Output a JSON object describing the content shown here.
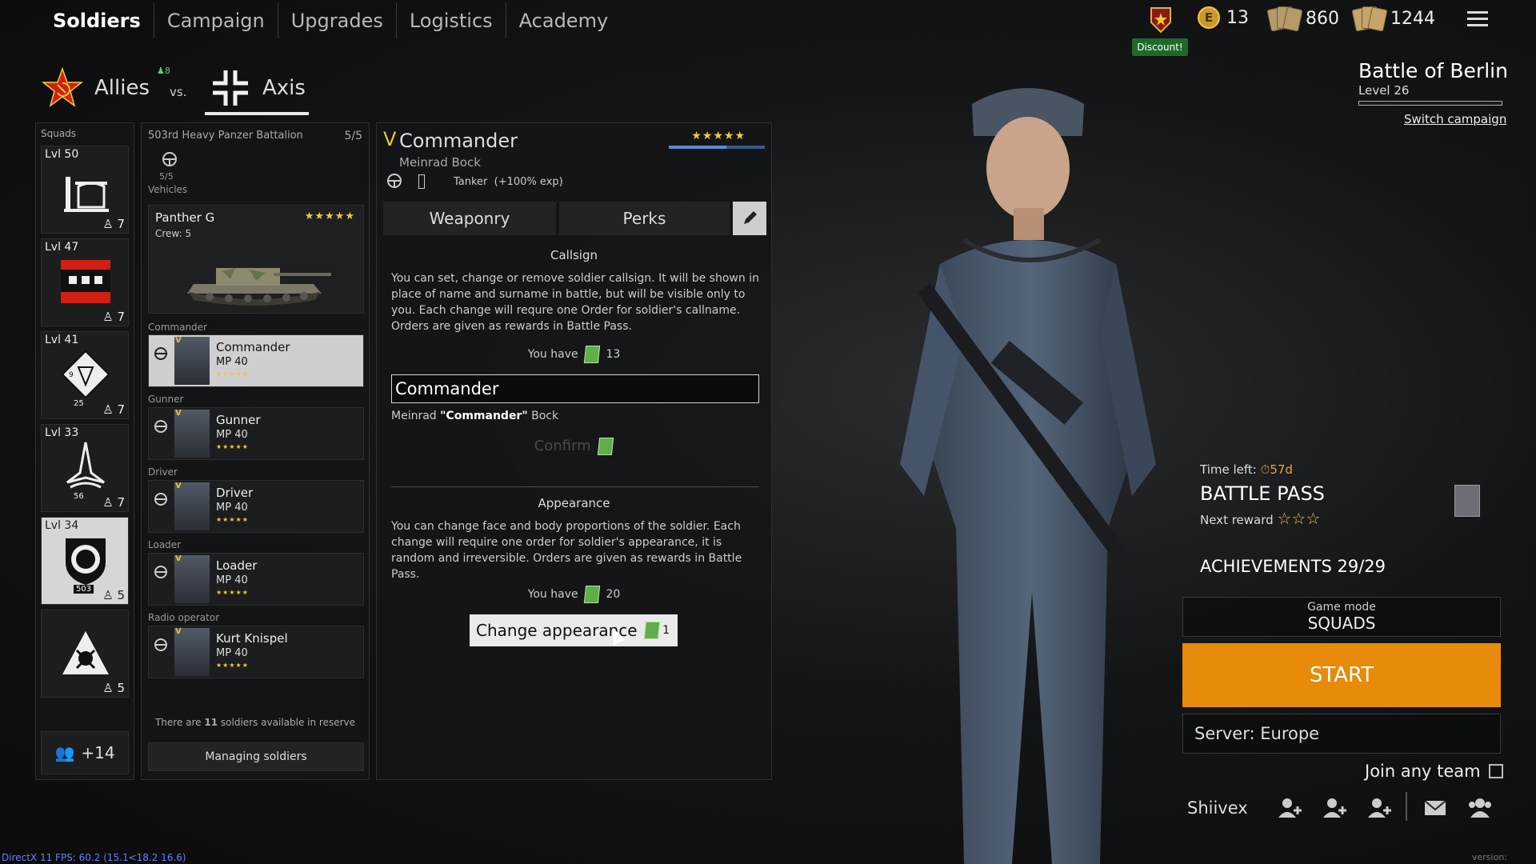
{
  "nav": {
    "tabs": [
      {
        "label": "Soldiers",
        "active": true
      },
      {
        "label": "Campaign",
        "active": false
      },
      {
        "label": "Upgrades",
        "active": false
      },
      {
        "label": "Logistics",
        "active": false
      },
      {
        "label": "Academy",
        "active": false
      }
    ]
  },
  "header": {
    "discount": "Discount!",
    "currency_e": "13",
    "currency_cards1": "860",
    "currency_cards2": "1244",
    "coin_letter": "E"
  },
  "faction": {
    "allies": "Allies",
    "vs": "vs.",
    "axis": "Axis",
    "online": "8"
  },
  "squads": {
    "title": "Squads",
    "items": [
      {
        "lvl": "Lvl 50",
        "count": "7"
      },
      {
        "lvl": "Lvl 47",
        "count": "7"
      },
      {
        "lvl": "Lvl 41",
        "count": "7",
        "badge": "25",
        "mark": "9"
      },
      {
        "lvl": "Lvl 33",
        "count": "7",
        "badge": "56"
      },
      {
        "lvl": "Lvl 34",
        "count": "5",
        "badge": "503"
      },
      {
        "lvl": "",
        "count": "5"
      }
    ],
    "reserve": "+14"
  },
  "squad_detail": {
    "name": "503rd Heavy Panzer Battalion",
    "count": "5/5",
    "vehicle_slot": "5/5",
    "vehicles_label": "Vehicles",
    "vehicle": {
      "name": "Panther G",
      "crew": "Crew: 5",
      "stars": "★★★★★"
    },
    "soldiers": [
      {
        "role": "Commander",
        "name": "Commander",
        "weapon": "MP 40",
        "stars": "★★★★★",
        "rank": "V"
      },
      {
        "role": "Gunner",
        "name": "Gunner",
        "weapon": "MP 40",
        "stars": "★★★★★",
        "rank": "V"
      },
      {
        "role": "Driver",
        "name": "Driver",
        "weapon": "MP 40",
        "stars": "★★★★★",
        "rank": "V"
      },
      {
        "role": "Loader",
        "name": "Loader",
        "weapon": "MP 40",
        "stars": "★★★★★",
        "rank": "V"
      },
      {
        "role": "Radio operator",
        "name": "Kurt Knispel",
        "weapon": "MP 40",
        "stars": "★★★★★",
        "rank": "V"
      }
    ],
    "reserve_text_pre": "There are",
    "reserve_count": "11",
    "reserve_text_post": "soldiers available in reserve",
    "manage": "Managing soldiers"
  },
  "soldier": {
    "rank": "V",
    "title": "Commander",
    "name": "Meinrad Bock",
    "class": "Tanker",
    "class_bonus": "(+100% exp)",
    "stars": "★★★★★",
    "tabs": {
      "weaponry": "Weaponry",
      "perks": "Perks"
    },
    "callsign": {
      "title": "Callsign",
      "text": "You can set, change or remove soldier callsign. It will be shown in place of name and surname in battle, but will be visible only to you. Each change will requre one Order for soldier's callname. Orders are given as rewards in Battle Pass.",
      "you_have": "You have",
      "orders": "13",
      "input_value": "Commander",
      "preview_first": "Meinrad",
      "preview_callsign": "\"Commander\"",
      "preview_last": "Bock",
      "confirm": "Confirm"
    },
    "appearance": {
      "title": "Appearance",
      "text": "You can change face and body proportions of the soldier. Each change will require one order for soldier's appearance, it is random and irreversible. Orders are given as rewards in Battle Pass.",
      "you_have": "You have",
      "orders": "20",
      "button": "Change appearance",
      "cost": "1"
    }
  },
  "campaign": {
    "title": "Battle of Berlin",
    "level": "Level 26",
    "switch": "Switch campaign"
  },
  "battle_pass": {
    "time_left_label": "Time left:",
    "time_left": "57d",
    "title": "BATTLE PASS",
    "next_reward": "Next reward",
    "next_stars": "☆☆☆"
  },
  "achievements": "ACHIEVEMENTS 29/29",
  "game_mode": {
    "label": "Game mode",
    "value": "SQUADS"
  },
  "start": "START",
  "server": "Server: Europe",
  "join_any_team": "Join any team",
  "username": "Shiivex",
  "fps": "DirectX 11 FPS: 60.2 (15.1<18.2 16.6)",
  "version": "version: 0.2.1.41",
  "colors": {
    "accent_orange": "#e88a0a",
    "gold": "#f0c93a",
    "discount_green": "#1f6a2b"
  }
}
